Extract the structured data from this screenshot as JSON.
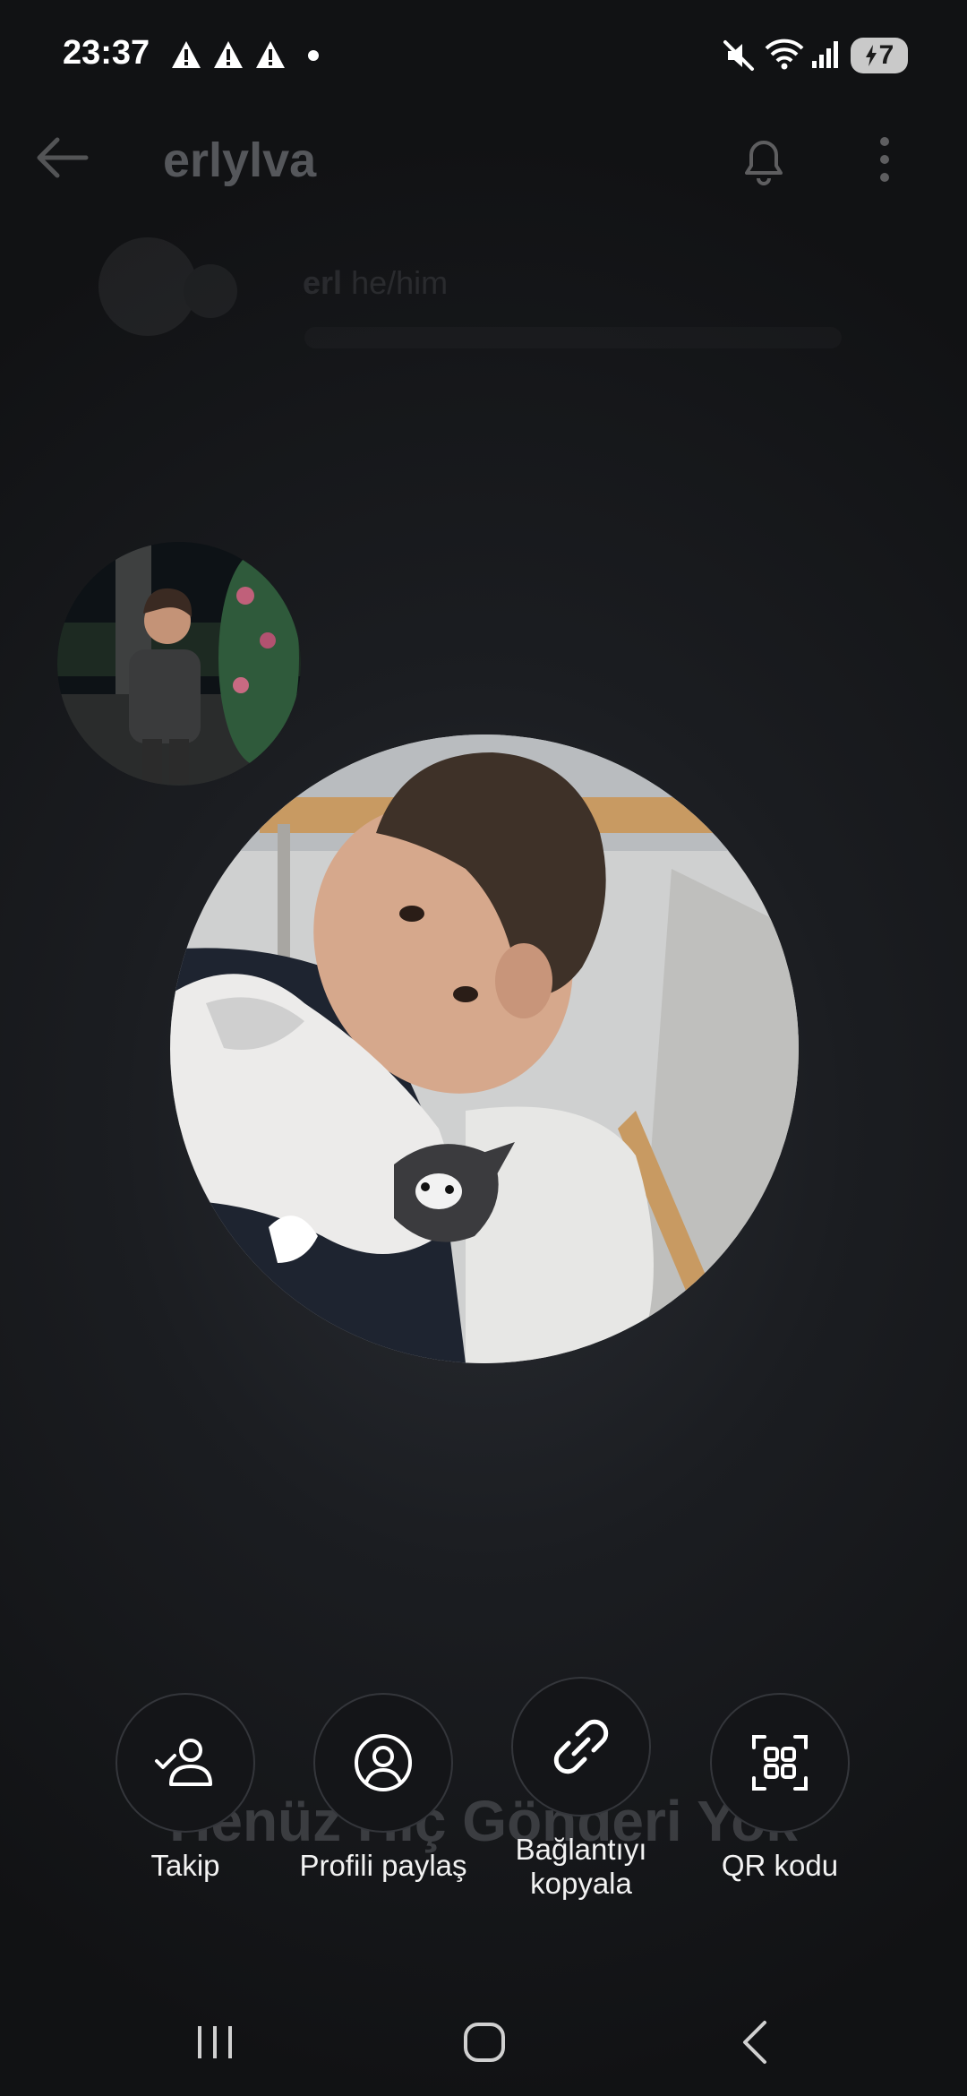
{
  "status_bar": {
    "time": "23:37",
    "battery_level": "7",
    "icons": [
      "warning-icon",
      "warning-icon",
      "warning-icon",
      "notification-dot",
      "mute-icon",
      "wifi-icon",
      "signal-icon",
      "battery-charging-icon"
    ]
  },
  "profile": {
    "username": "erlylva",
    "name": "erl",
    "pronouns": "he/him",
    "empty_posts_title": "Henüz Hiç Gönderi Yok"
  },
  "actions": [
    {
      "label": "Takip",
      "icon": "follow-user-icon"
    },
    {
      "label": "Profili paylaş",
      "icon": "profile-share-icon"
    },
    {
      "label": "Bağlantıyı kopyala",
      "icon": "link-icon"
    },
    {
      "label": "QR kodu",
      "icon": "qr-code-icon"
    }
  ],
  "nav": {
    "icons": [
      "recent-apps-icon",
      "home-icon",
      "back-icon"
    ]
  },
  "colors": {
    "background": "#1b1d21",
    "button_fill": "#141518",
    "button_border": "#34363b",
    "text": "#f2f2f2"
  }
}
